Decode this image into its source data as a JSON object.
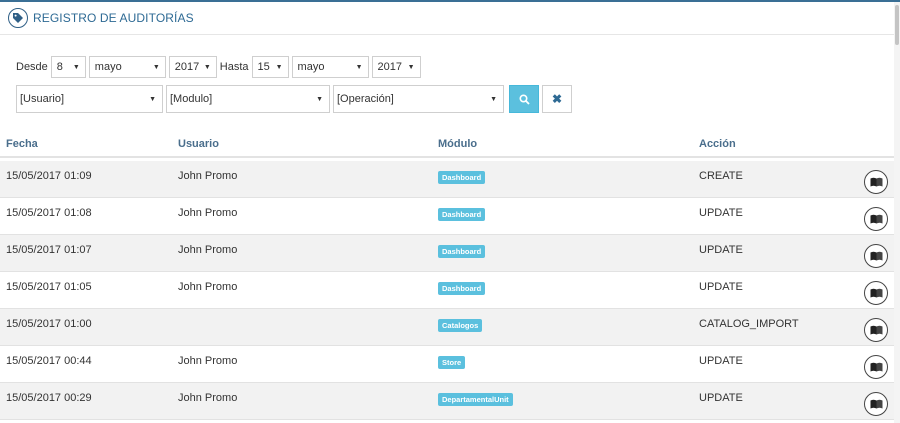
{
  "header": {
    "title": "REGISTRO DE AUDITORÍAS",
    "icon": "tag-icon"
  },
  "filters": {
    "desde_label": "Desde",
    "desde_day": "8",
    "desde_month": "mayo",
    "desde_year": "2017",
    "hasta_label": "Hasta",
    "hasta_day": "15",
    "hasta_month": "mayo",
    "hasta_year": "2017",
    "usuario": "[Usuario]",
    "modulo": "[Modulo]",
    "operacion": "[Operación]",
    "search_icon": "search-icon",
    "clear_icon": "close-icon",
    "clear_glyph": "✖"
  },
  "table": {
    "headers": {
      "fecha": "Fecha",
      "usuario": "Usuario",
      "modulo": "Módulo",
      "accion": "Acción"
    },
    "rows": [
      {
        "fecha": "15/05/2017 01:09",
        "usuario": "John Promo",
        "modulo": "Dashboard",
        "accion": "CREATE"
      },
      {
        "fecha": "15/05/2017 01:08",
        "usuario": "John Promo",
        "modulo": "Dashboard",
        "accion": "UPDATE"
      },
      {
        "fecha": "15/05/2017 01:07",
        "usuario": "John Promo",
        "modulo": "Dashboard",
        "accion": "UPDATE"
      },
      {
        "fecha": "15/05/2017 01:05",
        "usuario": "John Promo",
        "modulo": "Dashboard",
        "accion": "UPDATE"
      },
      {
        "fecha": "15/05/2017 01:00",
        "usuario": "",
        "modulo": "Catalogos",
        "accion": "CATALOG_IMPORT"
      },
      {
        "fecha": "15/05/2017 00:44",
        "usuario": "John Promo",
        "modulo": "Store",
        "accion": "UPDATE"
      },
      {
        "fecha": "15/05/2017 00:29",
        "usuario": "John Promo",
        "modulo": "DepartamentalUnit",
        "accion": "UPDATE"
      }
    ]
  },
  "colors": {
    "accent": "#2e6a94",
    "badge": "#5bc0de",
    "row_alt": "#f2f2f2"
  }
}
